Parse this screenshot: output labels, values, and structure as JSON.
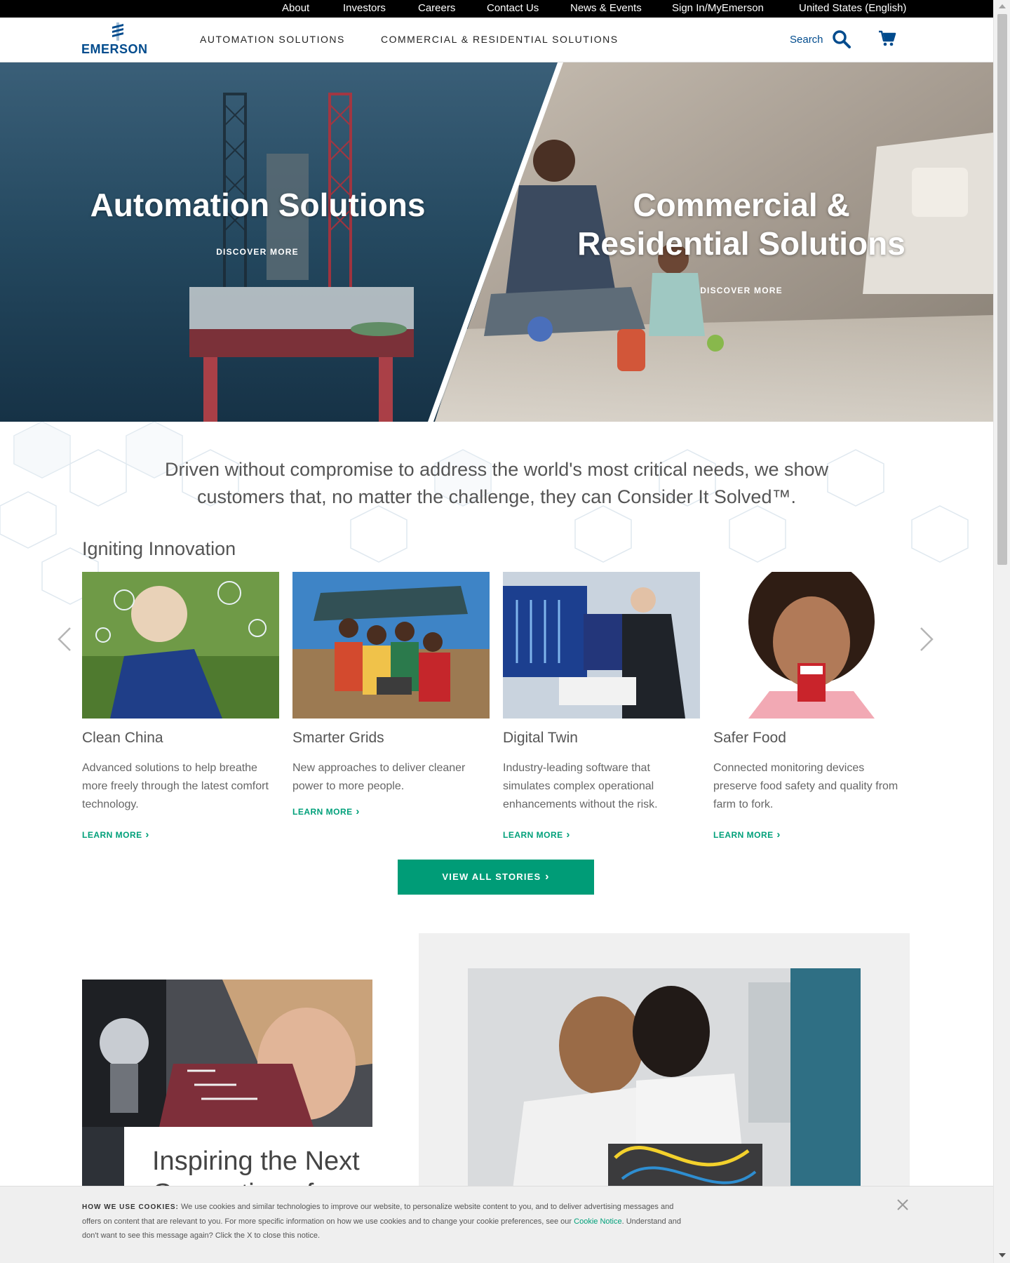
{
  "utility_nav": [
    "About",
    "Investors",
    "Careers",
    "Contact Us",
    "News & Events",
    "Sign In/MyEmerson",
    "United States (English)"
  ],
  "header": {
    "logo_text": "EMERSON",
    "nav": [
      "AUTOMATION SOLUTIONS",
      "COMMERCIAL & RESIDENTIAL SOLUTIONS"
    ],
    "search_label": "Search",
    "icons": {
      "search": "search-icon",
      "cart": "cart-icon",
      "logo": "emerson-logo-mark"
    }
  },
  "hero": {
    "left": {
      "title": "Automation Solutions",
      "link": "DISCOVER MORE"
    },
    "right": {
      "title_line1": "Commercial &",
      "title_line2": "Residential Solutions",
      "link": "DISCOVER MORE"
    }
  },
  "tagline_line1": "Driven without compromise to address the world's most critical needs, we show",
  "tagline_line2": "customers that, no matter the challenge, they can Consider It Solved™.",
  "innovation": {
    "title": "Igniting Innovation",
    "cards": [
      {
        "title": "Clean China",
        "description": "Advanced solutions to help breathe more freely through the latest comfort technology.",
        "link": "LEARN MORE"
      },
      {
        "title": "Smarter Grids",
        "description": "New approaches to deliver cleaner power to more people.",
        "link": "LEARN MORE"
      },
      {
        "title": "Digital Twin",
        "description": "Industry-leading software that simulates complex operational enhancements without the risk.",
        "link": "LEARN MORE"
      },
      {
        "title": "Safer Food",
        "description": "Connected monitoring devices preserve food safety and quality from farm to fork.",
        "link": "LEARN MORE"
      }
    ],
    "view_all": "VIEW ALL STORIES"
  },
  "feature": {
    "heading": "Inspiring the Next Generation of"
  },
  "cookie": {
    "label": "HOW WE USE COOKIES:",
    "text1": "We use cookies and similar technologies to improve our website, to personalize website content to you,  and to deliver advertising messages and offers on content that are relevant to you.  For more specific information on how we use cookies and to change your cookie preferences, see our",
    "link": "Cookie Notice",
    "text2": ".  Understand and don't want to see this message again?  Click the X to close this notice."
  },
  "colors": {
    "brand_blue": "#004b8d",
    "accent_green": "#009c77",
    "utility_bar": "#000000"
  }
}
